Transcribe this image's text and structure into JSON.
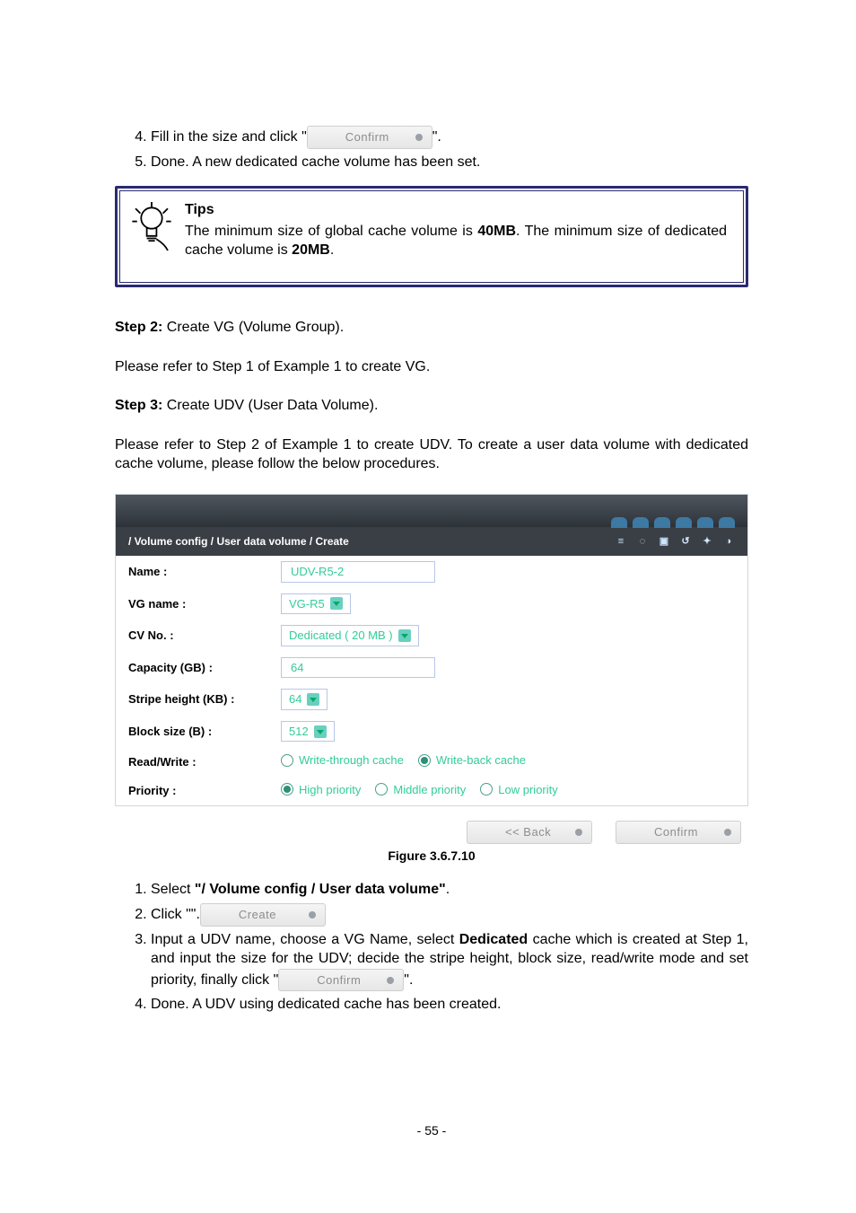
{
  "list_start": 4,
  "list_items": [
    {
      "pre": "Fill in the size and click \"",
      "btn": "Confirm",
      "post": "\"."
    },
    {
      "full": "Done. A new dedicated cache volume has been set."
    }
  ],
  "tips": {
    "title": "Tips",
    "line_a": "The  minimum  size  of  global  cache  volume  is  ",
    "bold_a": "40MB",
    "line_b": ".  The minimum size of dedicated cache volume is ",
    "bold_b": "20MB",
    "tail": "."
  },
  "step2": {
    "label": "Step 2:",
    "text": " Create VG (Volume Group)."
  },
  "para1": "Please refer to Step 1 of Example 1 to create VG.",
  "step3": {
    "label": "Step 3:",
    "text": " Create UDV (User Data Volume)."
  },
  "para2": "Please refer to Step 2 of Example 1 to create UDV. To create a user data volume with dedicated cache volume, please follow the below procedures.",
  "form": {
    "breadcrumb": "/ Volume config / User data volume / Create",
    "rows": [
      {
        "label": "Name :",
        "type": "input",
        "value": "UDV-R5-2"
      },
      {
        "label": "VG name :",
        "type": "select",
        "value": "VG-R5"
      },
      {
        "label": "CV No. :",
        "type": "select",
        "value": "Dedicated ( 20 MB )"
      },
      {
        "label": "Capacity (GB) :",
        "type": "input",
        "value": "64"
      },
      {
        "label": "Stripe height (KB) :",
        "type": "select",
        "value": "64"
      },
      {
        "label": "Block size (B) :",
        "type": "select",
        "value": "512"
      },
      {
        "label": "Read/Write :",
        "type": "radio",
        "options": [
          {
            "label": "Write-through cache",
            "on": false
          },
          {
            "label": "Write-back cache",
            "on": true
          }
        ]
      },
      {
        "label": "Priority :",
        "type": "radio",
        "options": [
          {
            "label": "High priority",
            "on": true
          },
          {
            "label": "Middle priority",
            "on": false
          },
          {
            "label": "Low priority",
            "on": false
          }
        ]
      }
    ],
    "buttons": {
      "back": "<< Back",
      "confirm": "Confirm"
    }
  },
  "figcap": "Figure 3.6.7.10",
  "listB_start": 1,
  "listB": [
    {
      "pre": "Select ",
      "bold": "\"/ Volume config / User data volume\"",
      "post": "."
    },
    {
      "pre": "Click \"",
      "btn": "Create",
      "post": "\"."
    },
    {
      "pre": "Input a UDV name, choose a VG Name, select ",
      "bold": "Dedicated",
      "post2": " cache which is created at Step 1, and input the size for the UDV; decide the stripe height,  block  size,  read/write  mode  and  set  priority,  finally  click \"",
      "btn": "Confirm",
      "tail": "\"."
    },
    {
      "full": "Done. A UDV using dedicated cache has been created."
    }
  ],
  "page_no": "- 55 -"
}
